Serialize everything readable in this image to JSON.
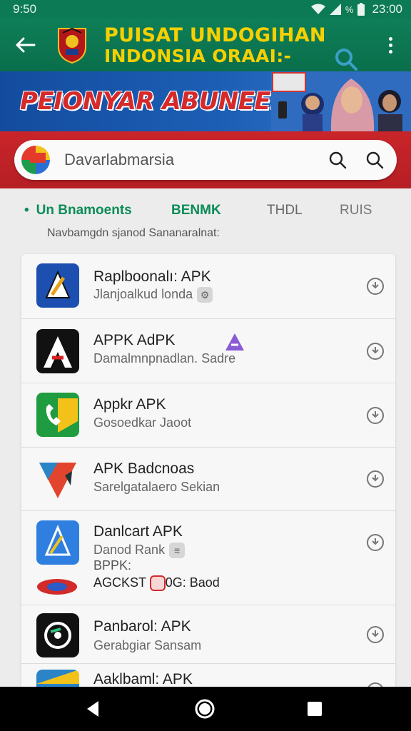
{
  "status_bar": {
    "time": "9:50",
    "battery": "%",
    "clock_right": "23:00"
  },
  "app_bar": {
    "title_line1": "PUISAT UNDOGIHAN",
    "title_line2": "INDONSIA ORAAI:-"
  },
  "banner": {
    "headline": "PEIONYAR ABUNEEIA!"
  },
  "search": {
    "value": "",
    "placeholder": "Davarlabmarsia"
  },
  "tabs": [
    {
      "label": "Un Bnamoents"
    },
    {
      "label": "BENMK"
    },
    {
      "label": "THDL"
    },
    {
      "label": "RUIS"
    }
  ],
  "subheading": "Navbamgdn sjanod Sananaralnat:",
  "apps": [
    {
      "name": "Raplboonalı: APK",
      "sub": "Jlanjoalkud londa",
      "sub2": ""
    },
    {
      "name": "APPK AdPK",
      "sub": "Damalmnpnadlan. Sadre",
      "sub2": ""
    },
    {
      "name": "Appkr APK",
      "sub": "Gosoedkar Jaoot",
      "sub2": ""
    },
    {
      "name": "APK Badcnoas",
      "sub": "Sarelgatalaero Sekian",
      "sub2": ""
    },
    {
      "name": "Danlcart APK",
      "sub": "Danod Rank",
      "sub2": "BPPK:",
      "sub3": "AGCKST",
      "sub3b": "0G: Baod"
    },
    {
      "name": "Panbarol: APK",
      "sub": "Gerabgiar Sansam",
      "sub2": ""
    },
    {
      "name": "Aaklbaml: APK",
      "sub": "",
      "sub2": ""
    }
  ],
  "colors": {
    "green": "#0c7a54",
    "yellow": "#f6d000",
    "red": "#c9252a",
    "blue": "#1d5fb5"
  }
}
